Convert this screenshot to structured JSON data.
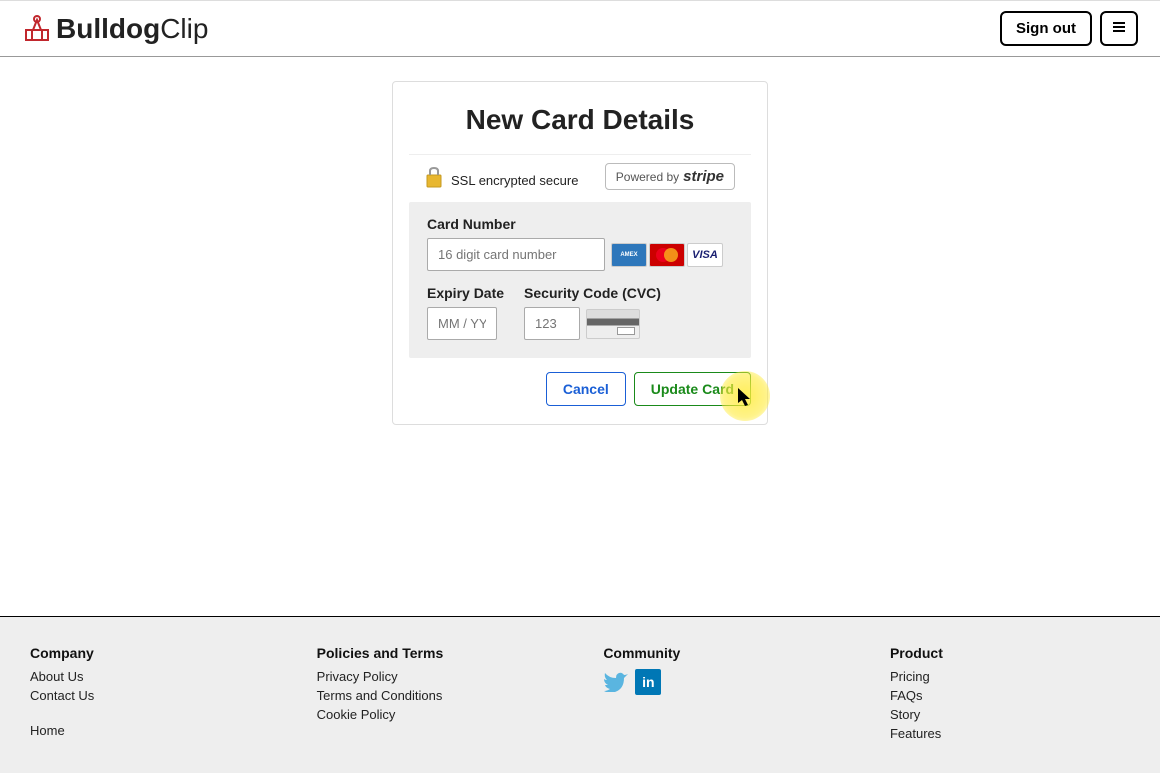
{
  "header": {
    "logo_bold": "Bulldog",
    "logo_light": "Clip",
    "sign_out": "Sign out"
  },
  "card": {
    "title": "New Card Details",
    "ssl_text": "SSL encrypted secure",
    "stripe_prefix": "Powered by",
    "stripe_name": "stripe",
    "card_number_label": "Card Number",
    "card_number_placeholder": "16 digit card number",
    "expiry_label": "Expiry Date",
    "expiry_placeholder": "MM / YY",
    "cvc_label": "Security Code (CVC)",
    "cvc_placeholder": "123",
    "cancel": "Cancel",
    "update": "Update Card"
  },
  "footer": {
    "company": {
      "heading": "Company",
      "about": "About Us",
      "contact": "Contact Us",
      "home": "Home"
    },
    "policies": {
      "heading": "Policies and Terms",
      "privacy": "Privacy Policy",
      "terms": "Terms and Conditions",
      "cookie": "Cookie Policy"
    },
    "community": {
      "heading": "Community"
    },
    "product": {
      "heading": "Product",
      "pricing": "Pricing",
      "faqs": "FAQs",
      "story": "Story",
      "features": "Features"
    }
  }
}
